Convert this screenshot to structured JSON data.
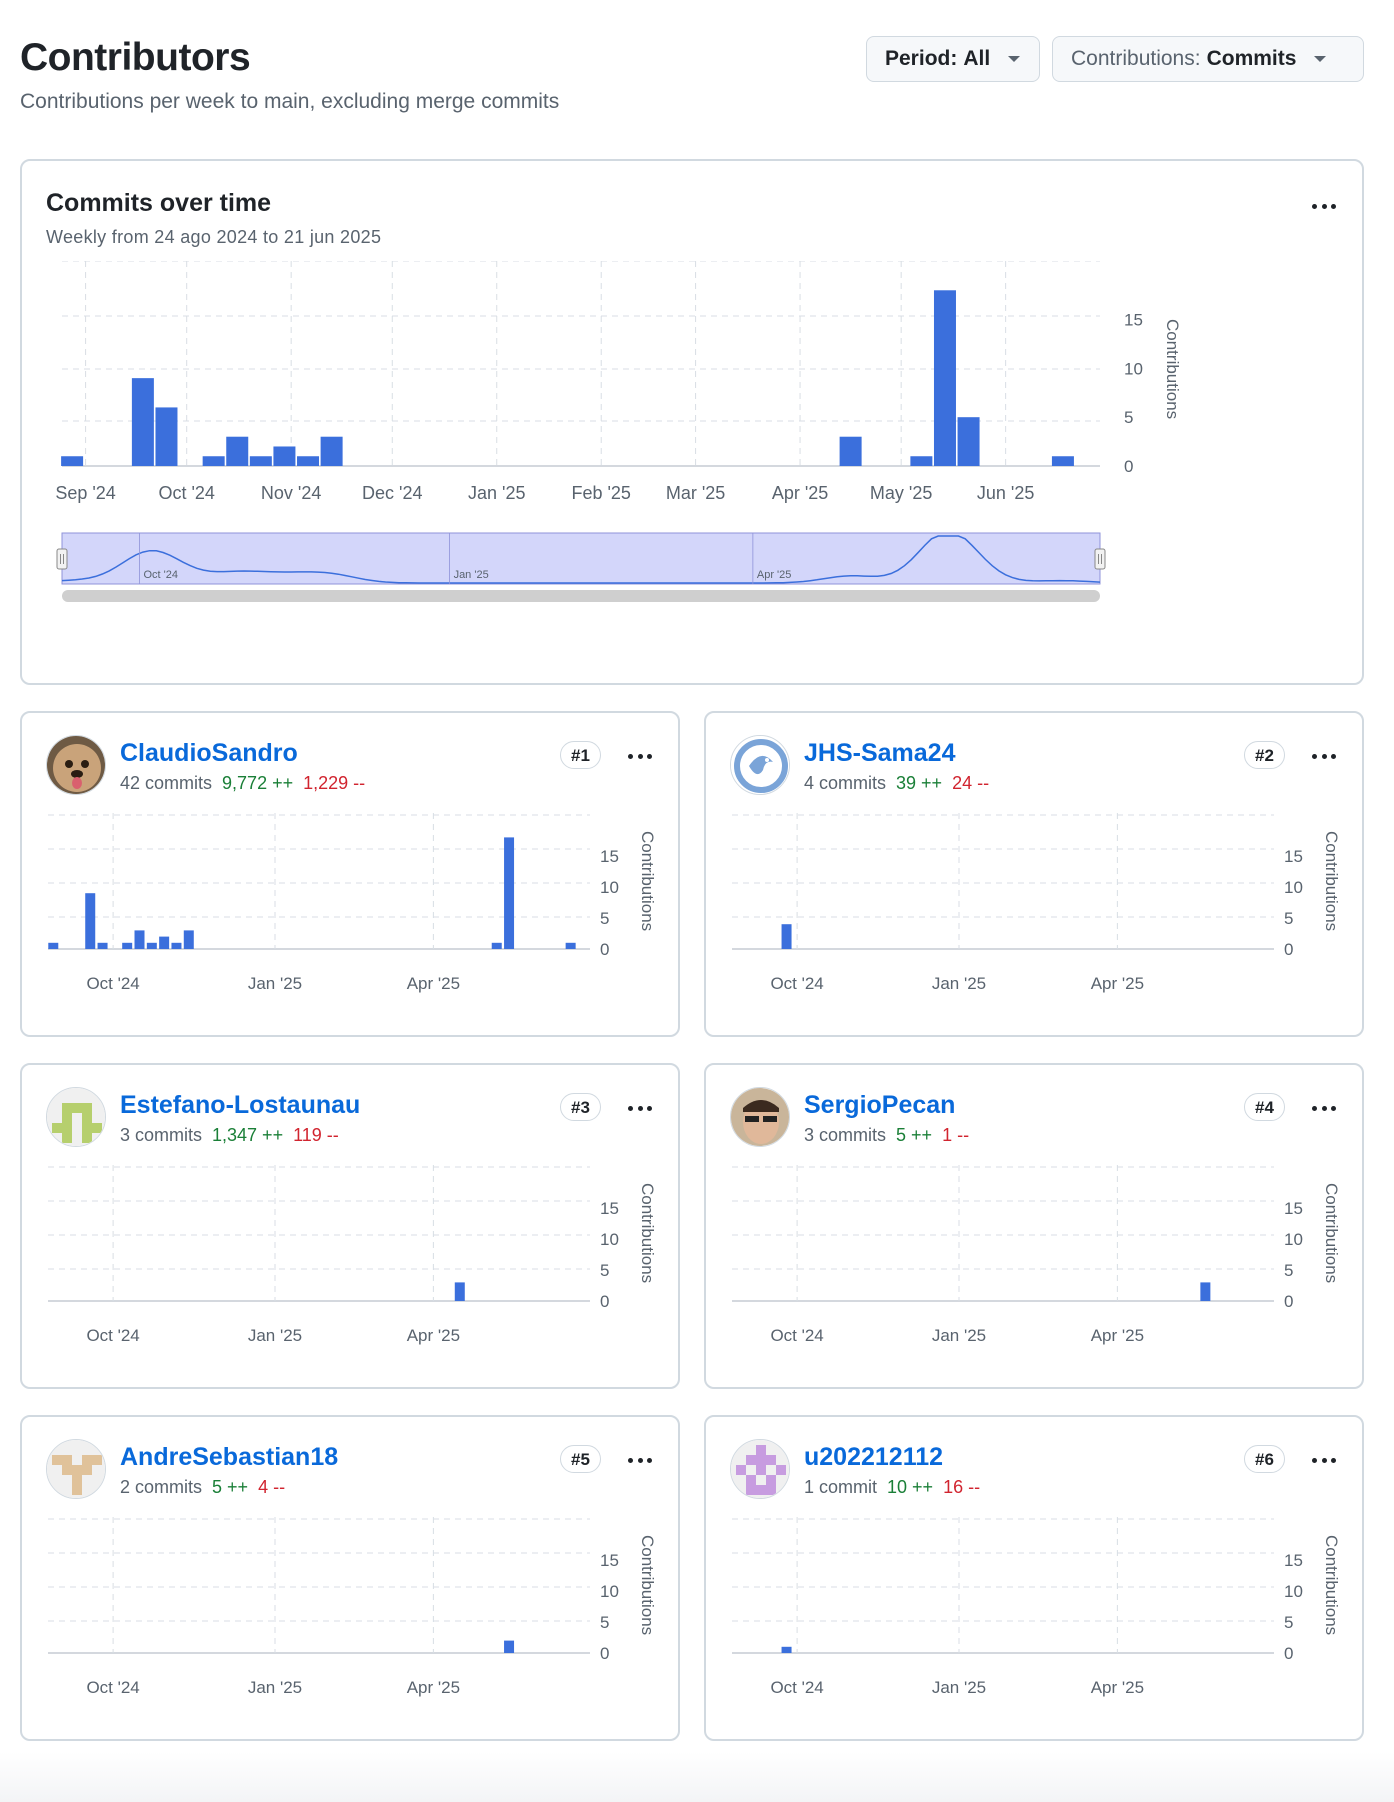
{
  "header": {
    "title": "Contributors",
    "subtitle": "Contributions per week to main, excluding merge commits",
    "period": {
      "label": "Period:",
      "value": "All"
    },
    "contributions": {
      "label": "Contributions:",
      "value": "Commits"
    }
  },
  "main_chart": {
    "title": "Commits over time",
    "subtitle": "Weekly from 24 ago 2024 to 21 jun 2025"
  },
  "colors": {
    "bar": "#3b6fdc",
    "added": "#1a7f37",
    "deleted": "#d1242f",
    "link": "#0969da"
  },
  "icons": [
    "kebab-icon",
    "caret-down-icon"
  ],
  "chart_data": [
    {
      "type": "bar",
      "x": [
        "2024-08-25",
        "2024-09-15",
        "2024-09-22",
        "2024-10-06",
        "2024-10-13",
        "2024-10-20",
        "2024-10-27",
        "2024-11-03",
        "2024-11-10",
        "2025-04-13",
        "2025-05-04",
        "2025-05-11",
        "2025-05-18",
        "2025-06-15"
      ],
      "values": [
        1,
        9,
        6,
        1,
        3,
        1,
        2,
        1,
        3,
        3,
        1,
        18,
        5,
        1
      ],
      "ticks": [
        "Sep '24",
        "Oct '24",
        "Nov '24",
        "Dec '24",
        "Jan '25",
        "Feb '25",
        "Mar '25",
        "Apr '25",
        "May '25",
        "Jun '25"
      ],
      "yticks": [
        0,
        5,
        10,
        15
      ],
      "ylabel": "Contributions",
      "ylim": [
        0,
        21
      ],
      "navigator_labels": [
        "Oct '24",
        "Jan '25",
        "Apr '25"
      ]
    },
    {
      "type": "bar",
      "x": [
        "2024-08-25",
        "2024-09-15",
        "2024-09-22",
        "2024-10-06",
        "2024-10-13",
        "2024-10-20",
        "2024-10-27",
        "2024-11-03",
        "2024-11-10",
        "2025-05-04",
        "2025-05-11",
        "2025-06-15"
      ],
      "values": [
        1,
        9,
        1,
        1,
        3,
        1,
        2,
        1,
        3,
        1,
        18,
        1
      ],
      "ticks": [
        "Oct '24",
        "Jan '25",
        "Apr '25"
      ],
      "yticks": [
        0,
        5,
        10,
        15
      ],
      "ylabel": "Contributions",
      "ylim": [
        0,
        20
      ]
    },
    {
      "type": "bar",
      "x": [
        "2024-09-22"
      ],
      "values": [
        4
      ],
      "ticks": [
        "Oct '24",
        "Jan '25",
        "Apr '25"
      ],
      "yticks": [
        0,
        5,
        10,
        15
      ],
      "ylabel": "Contributions",
      "ylim": [
        0,
        20
      ]
    },
    {
      "type": "bar",
      "x": [
        "2025-04-13"
      ],
      "values": [
        3
      ],
      "ticks": [
        "Oct '24",
        "Jan '25",
        "Apr '25"
      ],
      "yticks": [
        0,
        5,
        10,
        15
      ],
      "ylabel": "Contributions",
      "ylim": [
        0,
        20
      ]
    },
    {
      "type": "bar",
      "x": [
        "2025-05-18"
      ],
      "values": [
        3
      ],
      "ticks": [
        "Oct '24",
        "Jan '25",
        "Apr '25"
      ],
      "yticks": [
        0,
        5,
        10,
        15
      ],
      "ylabel": "Contributions",
      "ylim": [
        0,
        20
      ]
    },
    {
      "type": "bar",
      "x": [
        "2025-05-11"
      ],
      "values": [
        2
      ],
      "ticks": [
        "Oct '24",
        "Jan '25",
        "Apr '25"
      ],
      "yticks": [
        0,
        5,
        10,
        15
      ],
      "ylabel": "Contributions",
      "ylim": [
        0,
        20
      ]
    },
    {
      "type": "bar",
      "x": [
        "2024-09-22"
      ],
      "values": [
        1
      ],
      "ticks": [
        "Oct '24",
        "Jan '25",
        "Apr '25"
      ],
      "yticks": [
        0,
        5,
        10,
        15
      ],
      "ylabel": "Contributions",
      "ylim": [
        0,
        20
      ]
    }
  ],
  "contributors": [
    {
      "name": "ClaudioSandro",
      "commits": "42 commits",
      "additions": "9,772 ++",
      "deletions": "1,229 --",
      "rank": "#1",
      "avatar": "dog-photo-avatar"
    },
    {
      "name": "JHS-Sama24",
      "commits": "4 commits",
      "additions": "39 ++",
      "deletions": "24 --",
      "rank": "#2",
      "avatar": "dragon-logo-avatar"
    },
    {
      "name": "Estefano-Lostaunau",
      "commits": "3 commits",
      "additions": "1,347 ++",
      "deletions": "119 --",
      "rank": "#3",
      "avatar": "green-identicon-avatar"
    },
    {
      "name": "SergioPecan",
      "commits": "3 commits",
      "additions": "5 ++",
      "deletions": "1 --",
      "rank": "#4",
      "avatar": "person-photo-avatar"
    },
    {
      "name": "AndreSebastian18",
      "commits": "2 commits",
      "additions": "5 ++",
      "deletions": "4 --",
      "rank": "#5",
      "avatar": "tan-identicon-avatar"
    },
    {
      "name": "u202212112",
      "commits": "1 commit",
      "additions": "10 ++",
      "deletions": "16 --",
      "rank": "#6",
      "avatar": "purple-identicon-avatar"
    }
  ]
}
